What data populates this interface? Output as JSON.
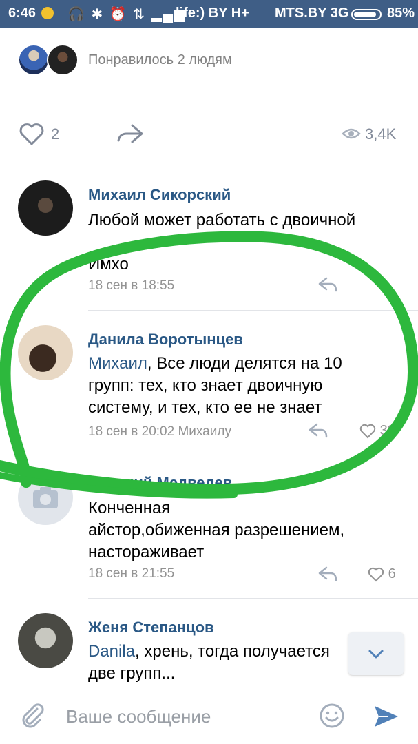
{
  "status_bar": {
    "time": "6:46",
    "carrier1": "life:) BY H+",
    "carrier2": "MTS.BY 3G",
    "battery": "85%"
  },
  "likes": {
    "text": "Понравилось 2 людям",
    "count": "2",
    "views": "3,4K"
  },
  "comments": [
    {
      "author": "Михаил Сикорский",
      "text_line1": "Любой может работать с двоичной",
      "text_line3": "Имхо",
      "meta": "18 сен в 18:55"
    },
    {
      "author": "Данила Воротынцев",
      "mention": "Михаил",
      "text_first": ", Все люди делятся на 10",
      "text_line2": "групп: тех, кто знает двоичную",
      "text_line3": "систему, и тех, кто ее не знает",
      "meta": "18 сен в 20:02 Михаилу",
      "likes": "38"
    },
    {
      "author": "Антоний Медведев",
      "text_line1": "Конченная",
      "text_line2": "айстор,обиженная разрешением,",
      "text_line3": "настораживает",
      "meta": "18 сен в 21:55",
      "likes": "6"
    },
    {
      "author": "Женя Степанцов",
      "mention": "Danila",
      "text_first": ", хрень, тогда получается",
      "text_line2": "две групп..."
    }
  ],
  "composer": {
    "placeholder": "Ваше сообщение"
  },
  "colors": {
    "status_bar": "#3f5e86",
    "link": "#2a5885",
    "marker": "#2db83d"
  }
}
